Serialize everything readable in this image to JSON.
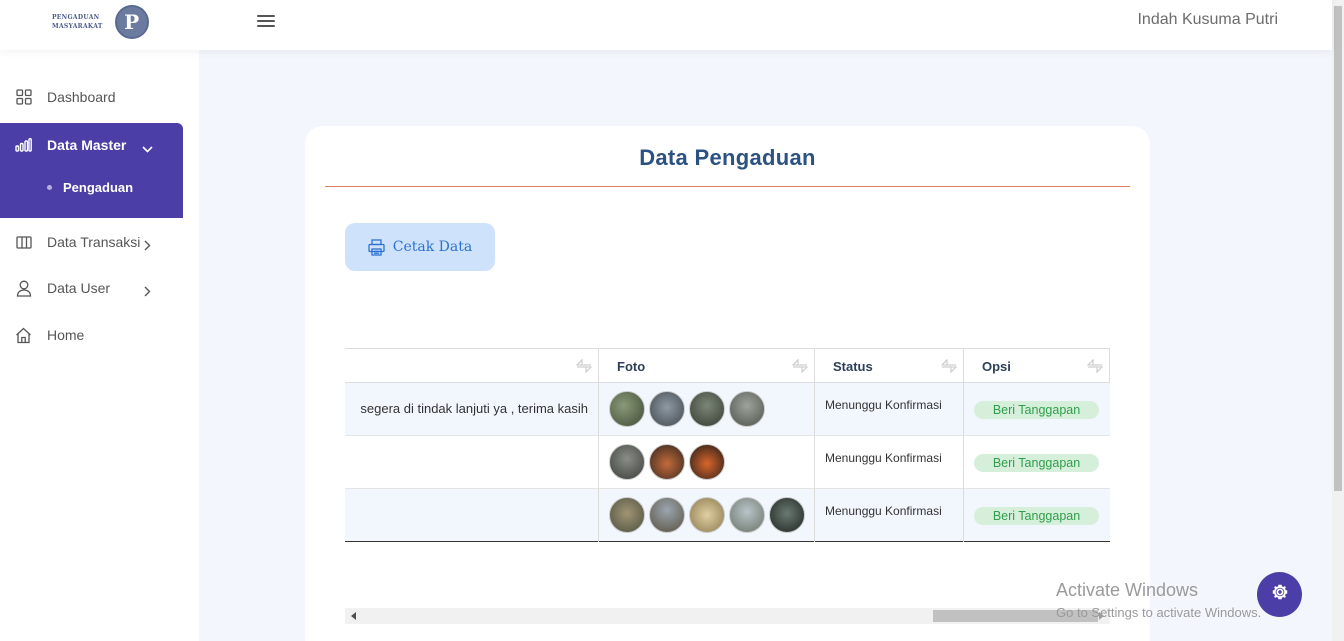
{
  "header": {
    "logo_line1": "PENGADUAN",
    "logo_line2": "MASYARAKAT",
    "logo_letter": "P",
    "user_name": "Indah Kusuma Putri"
  },
  "sidebar": {
    "items": [
      {
        "label": "Dashboard",
        "icon": "grid-icon"
      },
      {
        "label": "Data Master",
        "icon": "bar-chart-icon",
        "active": true
      },
      {
        "label": "Data Transaksi",
        "icon": "columns-icon"
      },
      {
        "label": "Data User",
        "icon": "user-icon"
      },
      {
        "label": "Home",
        "icon": "home-icon"
      }
    ],
    "subitems": [
      {
        "label": "Pengaduan"
      }
    ]
  },
  "main": {
    "title": "Data Pengaduan",
    "print_label": "Cetak  Data",
    "table": {
      "headers": [
        "",
        "Foto",
        "Status",
        "Opsi"
      ],
      "rows": [
        {
          "text": "segera di tindak lanjuti ya , terima kasih",
          "photos": 4,
          "status": "Menunggu Konfirmasi",
          "action": "Beri Tanggapan"
        },
        {
          "text": "",
          "photos": 3,
          "status": "Menunggu Konfirmasi",
          "action": "Beri Tanggapan"
        },
        {
          "text": "",
          "photos": 5,
          "status": "Menunggu Konfirmasi",
          "action": "Beri Tanggapan"
        }
      ]
    }
  },
  "overlay": {
    "activate_title": "Activate Windows",
    "activate_sub": "Go to Settings to activate Windows."
  },
  "colors": {
    "accent": "#4b3fa7",
    "title": "#2c5282",
    "respond_bg": "#d6efdb",
    "respond_text": "#2f9e4a",
    "print_bg": "#cfe2fb"
  }
}
